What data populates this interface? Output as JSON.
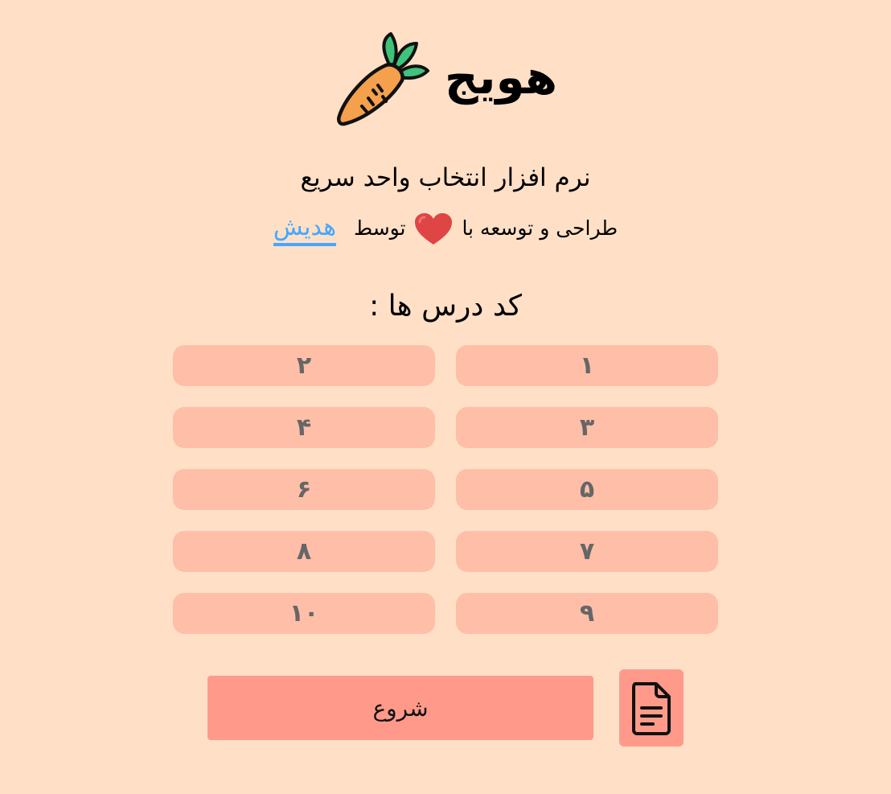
{
  "app": {
    "logo_text": "هویج",
    "logo_icon": "carrot-icon",
    "subtitle": "نرم افزار انتخاب واحد سریع",
    "credit_prefix": "طراحی و توسعه با",
    "credit_heart_icon": "heart-icon",
    "credit_by": "توسط",
    "author": "هدیش",
    "author_color": "#46a6ff"
  },
  "codes_section": {
    "title": "کد درس ها :",
    "codes": [
      "۱",
      "۲",
      "۳",
      "۴",
      "۵",
      "۶",
      "۷",
      "۸",
      "۹",
      "۱۰"
    ]
  },
  "actions": {
    "start_label": "شروع",
    "doc_icon": "document-icon"
  },
  "colors": {
    "background": "#ffe0c6",
    "code_button": "#ffbea7",
    "start_button": "#ff9a8a",
    "link": "#46a6ff"
  }
}
